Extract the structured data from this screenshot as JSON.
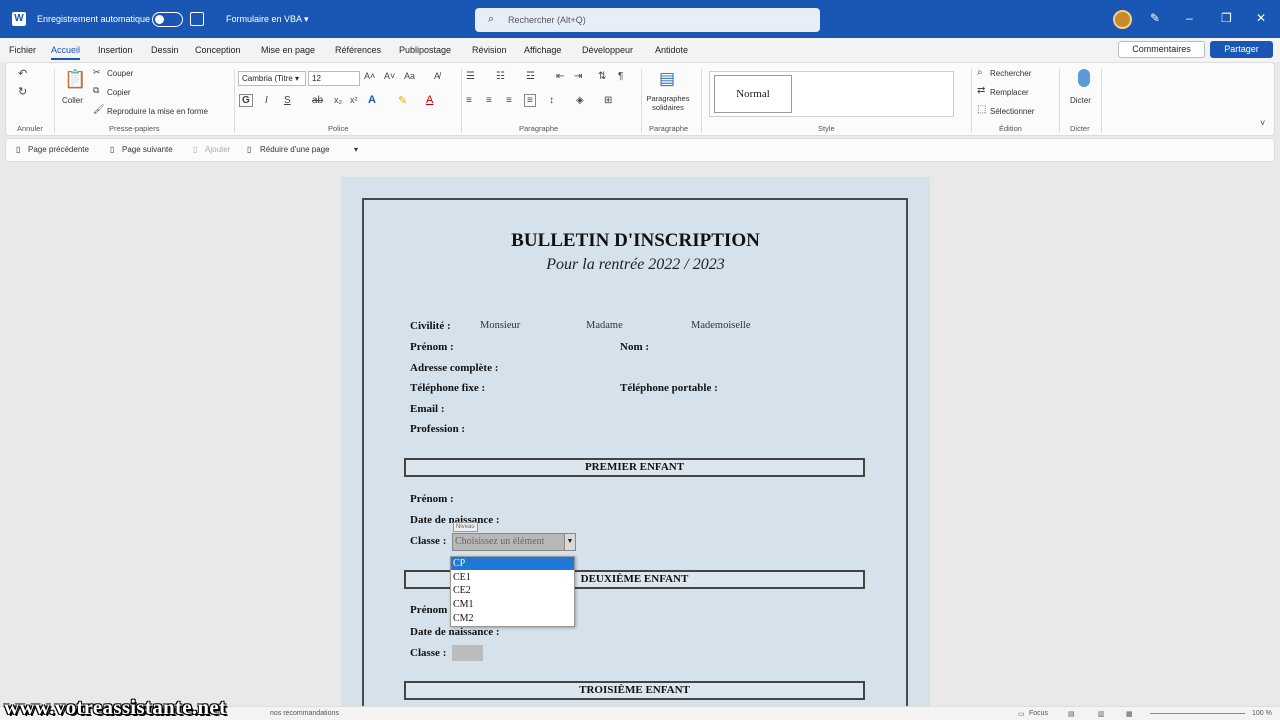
{
  "titlebar": {
    "autosave_label": "Enregistrement automatique",
    "doc_name": "Formulaire en VBA ▾",
    "search_placeholder": "Rechercher (Alt+Q)"
  },
  "menu": {
    "items": [
      "Fichier",
      "Accueil",
      "Insertion",
      "Dessin",
      "Conception",
      "Mise en page",
      "Références",
      "Publipostage",
      "Révision",
      "Affichage",
      "Développeur",
      "Antidote"
    ],
    "comments_label": "Commentaires",
    "share_label": "Partager"
  },
  "ribbon": {
    "groups": {
      "undo": "Annuler",
      "clipboard": "Presse-papiers",
      "font": "Police",
      "paragraph": "Paragraphe",
      "paragraph2": "Paragraphe",
      "style": "Style",
      "editing": "Édition",
      "dictate": "Dicter"
    },
    "clipboard": {
      "paste": "Coller",
      "cut": "Couper",
      "copy": "Copier",
      "format_painter": "Reproduire la mise en forme"
    },
    "font": {
      "name": "Cambria (Titre ▾",
      "size": "12"
    },
    "para_solidaires": "Paragraphes solidaires",
    "style_normal": "Normal",
    "editing": {
      "find": "Rechercher",
      "replace": "Remplacer",
      "select": "Sélectionner"
    },
    "dictate": "Dicter"
  },
  "navbar": {
    "prev": "Page précédente",
    "next": "Page suivante",
    "add": "Ajouter",
    "shrink": "Réduire d'une page"
  },
  "document": {
    "title": "BULLETIN D'INSCRIPTION",
    "subtitle": "Pour la rentrée 2022 / 2023",
    "civilite_label": "Civilité :",
    "civilite_options": [
      "Monsieur",
      "Madame",
      "Mademoiselle"
    ],
    "prenom_label": "Prénom :",
    "nom_label": "Nom :",
    "adresse_label": "Adresse complète :",
    "tel_fixe_label": "Téléphone fixe :",
    "tel_portable_label": "Téléphone portable :",
    "email_label": "Email :",
    "profession_label": "Profession :",
    "section1": "PREMIER ENFANT",
    "section2": "DEUXIÈME ENFANT",
    "section3": "TROISIÈME ENFANT",
    "child_prenom": "Prénom :",
    "child_naissance": "Date de naissance :",
    "child_classe": "Classe :"
  },
  "dropdown": {
    "tag": "Niveau",
    "placeholder": "Choisissez un élément",
    "options": [
      "CP",
      "CE1",
      "CE2",
      "CM1",
      "CM2"
    ],
    "selected": "CP"
  },
  "statusbar": {
    "text": "nos recommandations",
    "focus": "Focus",
    "zoom": "100 %"
  },
  "watermark": "www.votreassistante.net"
}
